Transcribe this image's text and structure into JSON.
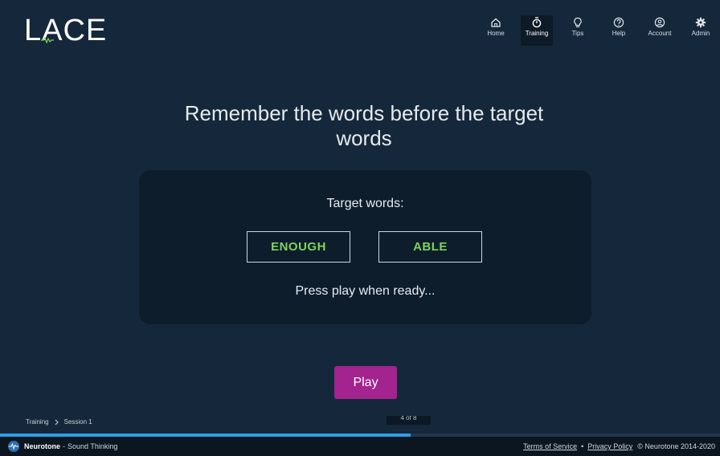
{
  "header": {
    "logo_text": "LACE",
    "nav": [
      {
        "label": "Home",
        "icon": "home-icon",
        "active": false
      },
      {
        "label": "Training",
        "icon": "stopwatch-icon",
        "active": true
      },
      {
        "label": "Tips",
        "icon": "lightbulb-icon",
        "active": false
      },
      {
        "label": "Help",
        "icon": "help-icon",
        "active": false
      },
      {
        "label": "Account",
        "icon": "account-icon",
        "active": false
      },
      {
        "label": "Admin",
        "icon": "gear-icon",
        "active": false
      }
    ]
  },
  "main": {
    "title": "Remember the words before the target words",
    "target_label": "Target words:",
    "target_words": [
      "ENOUGH",
      "ABLE"
    ],
    "ready_text": "Press play when ready...",
    "play_label": "Play",
    "progress_counter": "4 of 8",
    "progress_fraction": 0.57
  },
  "breadcrumb": {
    "items": [
      "Training",
      "Session 1"
    ]
  },
  "footer": {
    "brand_name": "Neurotone",
    "brand_separator": "-",
    "brand_tagline": "Sound Thinking",
    "terms": "Terms of Service",
    "separator": "•",
    "privacy": "Privacy Policy",
    "copyright": "© Neurotone 2014-2020"
  },
  "colors": {
    "background": "#15283b",
    "card": "#0d1d2c",
    "accent_green": "#7fd35d",
    "play_button": "#a3238f",
    "progress": "#2f9fe8"
  }
}
